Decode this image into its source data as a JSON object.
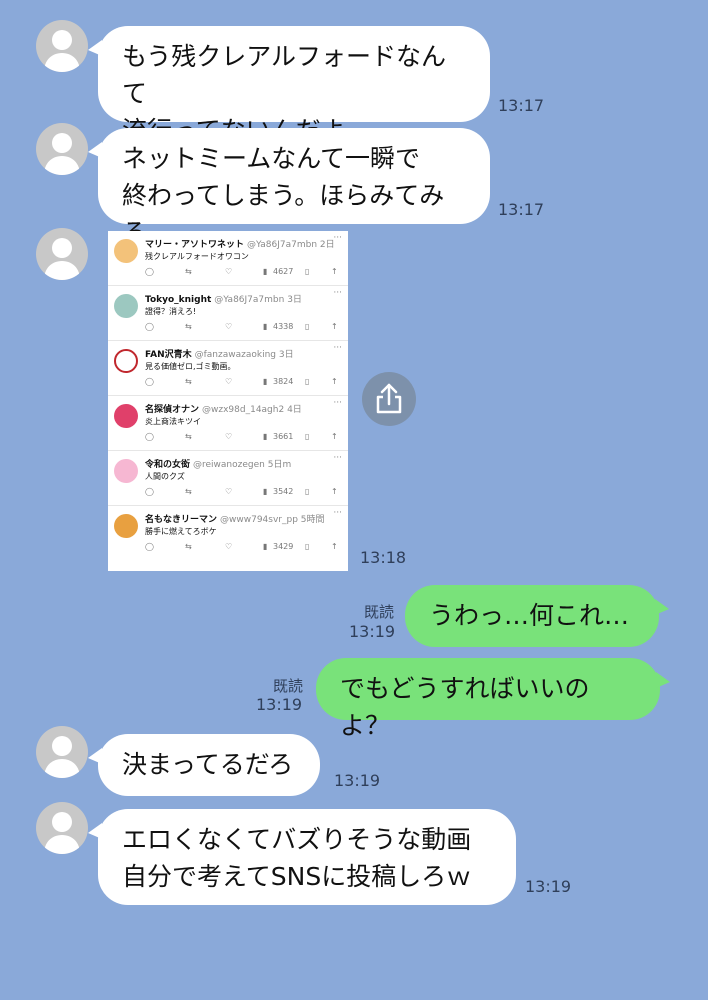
{
  "messages": [
    {
      "text": "もう残クレアルフォードなんて\n流行ってないんだよ",
      "time": "13:17"
    },
    {
      "text": "ネットミームなんて一瞬で\n終わってしまう。ほらみてみろ",
      "time": "13:17"
    },
    {
      "time": "13:18"
    },
    {
      "text": "うわっ…何これ…",
      "time": "13:19",
      "read": "既読"
    },
    {
      "text": "でもどうすればいいのよ？",
      "time": "13:19",
      "read": "既読"
    },
    {
      "text": "決まってるだろ",
      "time": "13:19"
    },
    {
      "text": "エロくなくてバズりそうな動画\n自分で考えてSNSに投稿しろｗ",
      "time": "13:19"
    }
  ],
  "tweets": [
    {
      "name": "マリー・アソトワネット",
      "handle": "@Ya86J7a7mbn 2日",
      "body": "残クレアルフォードオワコン",
      "views": "4627",
      "avatar_color": "#f3c27a"
    },
    {
      "name": "Tokyo_knight",
      "handle": "@Ya86J7a7mbn 3日",
      "body": "證得？消えろ!",
      "views": "4338",
      "avatar_color": "#9cc8c0"
    },
    {
      "name": "FAN沢青木",
      "handle": "@fanzawazaoking 3日",
      "body": "見る価値ゼロ,ゴミ動画。",
      "views": "3824",
      "avatar_color": "#e7e7e7"
    },
    {
      "name": "名探偵オナン",
      "handle": "@wzx98d_14agh2 4日",
      "body": "炎上商法キツイ",
      "views": "3661",
      "avatar_color": "#e0406a"
    },
    {
      "name": "令和の女衒",
      "handle": "@reiwanozegen 5日m",
      "body": "人間のクズ",
      "views": "3542",
      "avatar_color": "#f6b7d2"
    },
    {
      "name": "名もなきリーマン",
      "handle": "@www794svr_pp 5時間",
      "body": "勝手に燃えてろボケ",
      "views": "3429",
      "avatar_color": "#e8a040"
    }
  ],
  "icons": {
    "avatar": "default-user-icon",
    "share": "share-icon"
  },
  "colors": {
    "background": "#8aa9d9",
    "incoming_bubble": "#ffffff",
    "outgoing_bubble": "#79e27a"
  }
}
